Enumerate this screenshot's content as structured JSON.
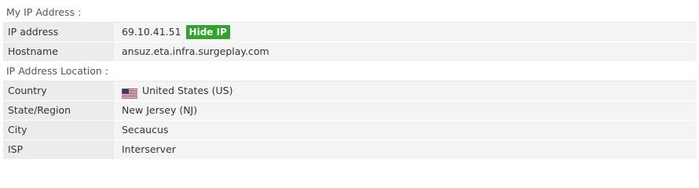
{
  "sections": {
    "my_ip": {
      "header": "My IP Address :",
      "rows": [
        {
          "label": "IP address",
          "value": "69.10.41.51",
          "action": "Hide IP"
        },
        {
          "label": "Hostname",
          "value": "ansuz.eta.infra.surgeplay.com"
        }
      ]
    },
    "location": {
      "header": "IP Address Location :",
      "rows": [
        {
          "label": "Country",
          "value": "United States (US)",
          "icon": "us-flag-icon"
        },
        {
          "label": "State/Region",
          "value": "New Jersey (NJ)"
        },
        {
          "label": "City",
          "value": "Secaucus"
        },
        {
          "label": "ISP",
          "value": "Interserver"
        }
      ]
    }
  },
  "colors": {
    "hide_button": "#2fa52b",
    "label_bg": "#ececec",
    "value_bg": "#f4f4f4"
  }
}
